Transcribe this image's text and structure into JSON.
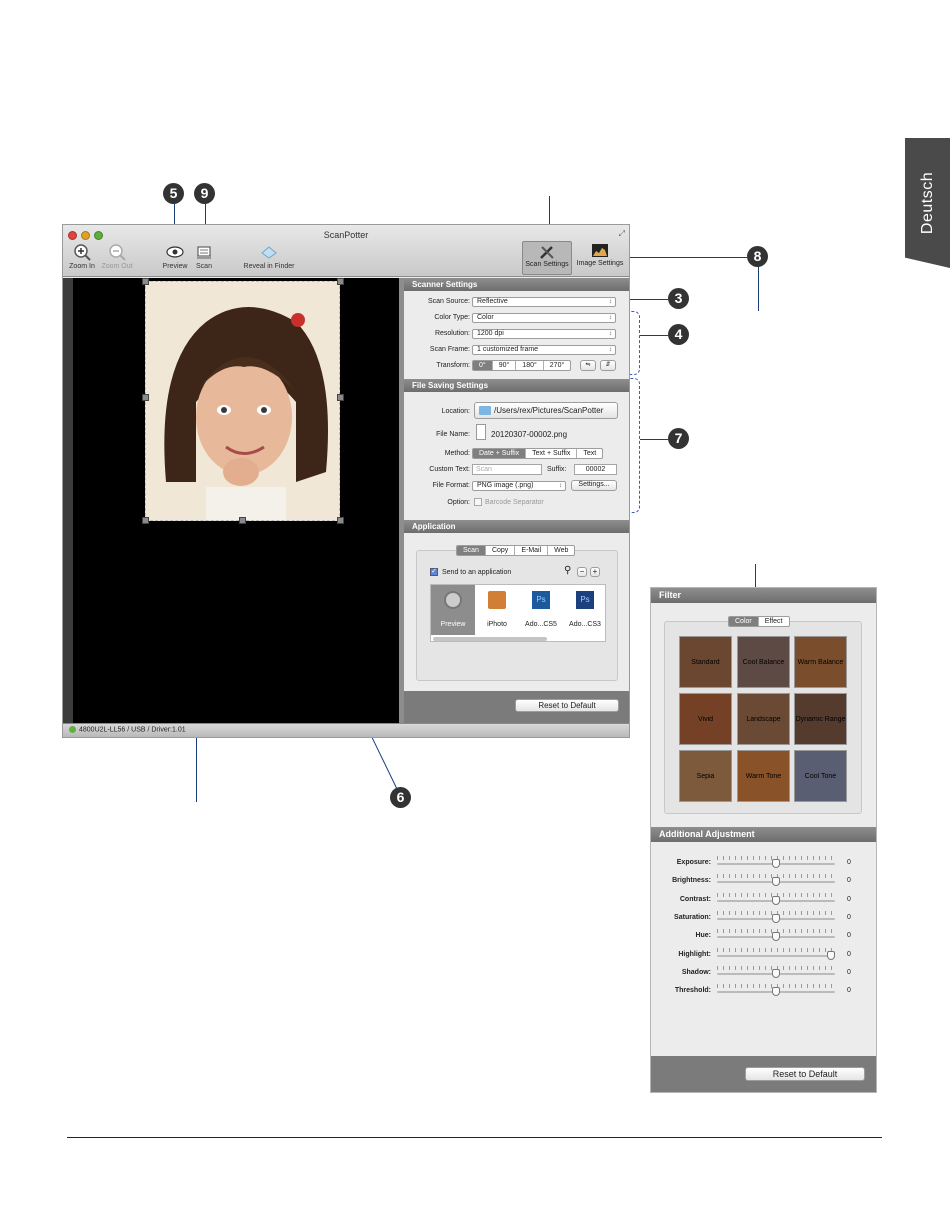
{
  "side_tab": {
    "label": "Deutsch"
  },
  "window": {
    "title": "ScanPotter",
    "toolbar": {
      "zoom_in": "Zoom In",
      "zoom_out": "Zoom Out",
      "preview": "Preview",
      "scan": "Scan",
      "reveal": "Reveal in Finder",
      "scan_settings": "Scan Settings",
      "image_settings": "Image Settings"
    },
    "status": "4800U2L-LL56 / USB / Driver:1.01"
  },
  "scanner_settings": {
    "header": "Scanner Settings",
    "scan_source_label": "Scan Source:",
    "scan_source_value": "Reflective",
    "color_type_label": "Color Type:",
    "color_type_value": "Color",
    "resolution_label": "Resolution:",
    "resolution_value": "1200 dpi",
    "scan_frame_label": "Scan Frame:",
    "scan_frame_value": "1 customized frame",
    "transform_label": "Transform:",
    "transform_options": [
      "0°",
      "90°",
      "180°",
      "270°"
    ]
  },
  "file_saving": {
    "header": "File Saving Settings",
    "location_label": "Location:",
    "location_value": "/Users/rex/Pictures/ScanPotter",
    "file_name_label": "File Name:",
    "file_name_value": "20120307-00002.png",
    "method_label": "Method:",
    "method_options": [
      "Date + Suffix",
      "Text + Suffix",
      "Text"
    ],
    "custom_text_label": "Custom Text:",
    "custom_text_placeholder": "Scan",
    "suffix_label": "Suffix:",
    "suffix_value": "00002",
    "file_format_label": "File Format:",
    "file_format_value": "PNG image (.png)",
    "settings_button": "Settings...",
    "option_label": "Option:",
    "barcode_label": "Barcode Separator"
  },
  "application": {
    "header": "Application",
    "tabs": [
      "Scan",
      "Copy",
      "E-Mail",
      "Web"
    ],
    "send_to_label": "Send to an application",
    "apps": [
      "Preview",
      "iPhoto",
      "Ado...CS5",
      "Ado...CS3"
    ],
    "reset_button": "Reset to Default"
  },
  "callouts": [
    "5",
    "9",
    "3",
    "4",
    "7",
    "8",
    "6"
  ],
  "filter": {
    "header": "Filter",
    "tabs": [
      "Color",
      "Effect"
    ],
    "thumbs": [
      "Standard",
      "Cool Balance",
      "Warm Balance",
      "Vivid",
      "Landscape",
      "Dynamic Range",
      "Sepia",
      "Warm Tone",
      "Cool Tone"
    ],
    "additional_header": "Additional Adjustment",
    "adjustments": [
      {
        "label": "Exposure:",
        "value": "0",
        "level": 0.5
      },
      {
        "label": "Brightness:",
        "value": "0",
        "level": 0.5
      },
      {
        "label": "Contrast:",
        "value": "0",
        "level": 0.5
      },
      {
        "label": "Saturation:",
        "value": "0",
        "level": 0.5
      },
      {
        "label": "Hue:",
        "value": "0",
        "level": 0.5
      },
      {
        "label": "Highlight:",
        "value": "0",
        "level": 1.0
      },
      {
        "label": "Shadow:",
        "value": "0",
        "level": 0.5
      },
      {
        "label": "Threshold:",
        "value": "0",
        "level": 0.5
      }
    ],
    "reset_button": "Reset to Default"
  }
}
